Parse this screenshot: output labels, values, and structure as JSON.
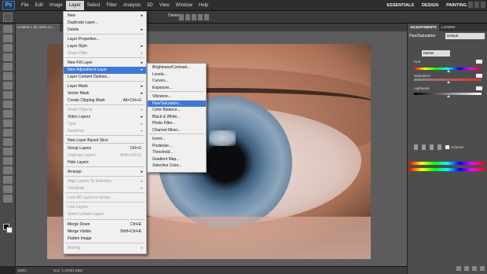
{
  "menubar": {
    "logo": "Ps",
    "items": [
      "File",
      "Edit",
      "Image",
      "Layer",
      "Select",
      "Filter",
      "Analysis",
      "3D",
      "View",
      "Window",
      "Help"
    ],
    "active_index": 3,
    "workspaces": [
      "ESSENTIALS",
      "DESIGN",
      "PAINTING"
    ]
  },
  "options_bar": {
    "delete_label": "Delete"
  },
  "document": {
    "tab_title": "Untitled-1 @ 100% (H...",
    "zoom": "100%",
    "doc_size": "Doc: 1.37M/1.92M"
  },
  "layer_menu": {
    "items": [
      {
        "label": "New",
        "arrow": true,
        "disabled": false
      },
      {
        "label": "Duplicate Layer...",
        "arrow": false,
        "disabled": false
      },
      {
        "label": "Delete",
        "arrow": true,
        "disabled": false
      },
      {
        "label": "Layer Properties...",
        "arrow": false,
        "disabled": false
      },
      {
        "label": "Layer Style",
        "arrow": true,
        "disabled": false
      },
      {
        "label": "Smart Filter",
        "arrow": true,
        "disabled": true
      },
      {
        "label": "New Fill Layer",
        "arrow": true,
        "disabled": false
      },
      {
        "label": "New Adjustment Layer",
        "arrow": true,
        "disabled": false
      },
      {
        "label": "Layer Content Options...",
        "arrow": false,
        "disabled": false
      },
      {
        "label": "Layer Mask",
        "arrow": true,
        "disabled": false
      },
      {
        "label": "Vector Mask",
        "arrow": true,
        "disabled": false
      },
      {
        "label": "Create Clipping Mask",
        "shortcut": "Alt+Ctrl+G",
        "disabled": false
      },
      {
        "label": "Smart Objects",
        "arrow": true,
        "disabled": true
      },
      {
        "label": "Video Layers",
        "arrow": true,
        "disabled": false
      },
      {
        "label": "Type",
        "arrow": true,
        "disabled": true
      },
      {
        "label": "Rasterize",
        "arrow": true,
        "disabled": true
      },
      {
        "label": "New Layer Based Slice",
        "arrow": false,
        "disabled": false
      },
      {
        "label": "Group Layers",
        "shortcut": "Ctrl+G",
        "disabled": false
      },
      {
        "label": "Ungroup Layers",
        "shortcut": "Shift+Ctrl+G",
        "disabled": true
      },
      {
        "label": "Hide Layers",
        "arrow": false,
        "disabled": false
      },
      {
        "label": "Arrange",
        "arrow": true,
        "disabled": false
      },
      {
        "label": "Align Layers To Selection",
        "arrow": true,
        "disabled": true
      },
      {
        "label": "Distribute",
        "arrow": true,
        "disabled": true
      },
      {
        "label": "Lock All Layers in Group...",
        "arrow": false,
        "disabled": true
      },
      {
        "label": "Link Layers",
        "arrow": false,
        "disabled": true
      },
      {
        "label": "Select Linked Layers",
        "arrow": false,
        "disabled": true
      },
      {
        "label": "Merge Down",
        "shortcut": "Ctrl+E",
        "disabled": false
      },
      {
        "label": "Merge Visible",
        "shortcut": "Shift+Ctrl+E",
        "disabled": false
      },
      {
        "label": "Flatten Image",
        "arrow": false,
        "disabled": false
      },
      {
        "label": "Matting",
        "arrow": true,
        "disabled": true
      }
    ],
    "highlighted": "New Adjustment Layer"
  },
  "adjustment_submenu": {
    "items": [
      "Brightness/Contrast...",
      "Levels...",
      "Curves...",
      "Exposure...",
      "Vibrance...",
      "Hue/Saturation...",
      "Color Balance...",
      "Black & White...",
      "Photo Filter...",
      "Channel Mixer...",
      "Invert...",
      "Posterize...",
      "Threshold...",
      "Gradient Map...",
      "Selective Color..."
    ],
    "highlighted": "Hue/Saturation..."
  },
  "panel": {
    "tabs": [
      "ADJUSTMENTS",
      "LAYERS"
    ],
    "title": "Hue/Saturation",
    "preset": "Default",
    "channel": "Master",
    "hue_label": "Hue:",
    "saturation_label": "Saturation:",
    "lightness_label": "Lightness:",
    "hue": 0,
    "saturation": 0,
    "lightness": 0,
    "colorize_label": "Colorize"
  }
}
